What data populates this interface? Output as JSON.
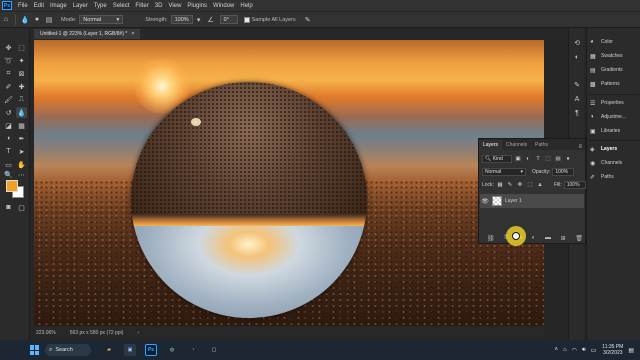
{
  "app": {
    "logo": "Ps"
  },
  "menu": [
    "File",
    "Edit",
    "Image",
    "Layer",
    "Type",
    "Select",
    "Filter",
    "3D",
    "View",
    "Plugins",
    "Window",
    "Help"
  ],
  "options": {
    "mode_label": "Mode:",
    "mode_value": "Normal",
    "strength_label": "Strength:",
    "strength_value": "100%",
    "angle_value": "0°",
    "sample_all_layers": "Sample All Layers"
  },
  "document": {
    "tab_title": "Untitled-1 @ 223% (Layer 1, RGB/8#) *",
    "close": "×"
  },
  "status": {
    "zoom": "223.06%",
    "size": "563 px x 580 px (72 ppi)"
  },
  "dock_panels": [
    {
      "icon": "color-icon",
      "label": "Color"
    },
    {
      "icon": "swatches-icon",
      "label": "Swatches"
    },
    {
      "icon": "gradients-icon",
      "label": "Gradients"
    },
    {
      "icon": "patterns-icon",
      "label": "Patterns"
    },
    {
      "icon": "properties-icon",
      "label": "Properties"
    },
    {
      "icon": "adjustments-icon",
      "label": "Adjustme..."
    },
    {
      "icon": "libraries-icon",
      "label": "Libraries"
    },
    {
      "icon": "layers-icon",
      "label": "Layers"
    },
    {
      "icon": "channels-icon",
      "label": "Channels"
    },
    {
      "icon": "paths-icon",
      "label": "Paths"
    }
  ],
  "layers_panel": {
    "tabs": [
      "Layers",
      "Channels",
      "Paths"
    ],
    "kind": "Kind",
    "blend_mode": "Normal",
    "opacity_label": "Opacity:",
    "opacity_value": "100%",
    "lock_label": "Lock:",
    "fill_label": "Fill:",
    "fill_value": "100%",
    "layer_name": "Layer 1"
  },
  "taskbar": {
    "search": "Search",
    "time": "11:35 PM",
    "date": "3/2/2023",
    "apps": [
      "Ps"
    ]
  },
  "colors": {
    "foreground": "#f29f22",
    "background": "#ffffff",
    "accent": "#31a8ff"
  }
}
